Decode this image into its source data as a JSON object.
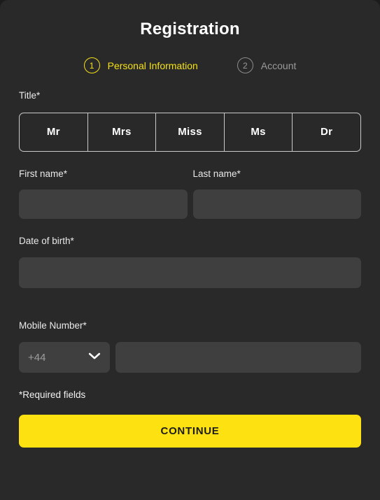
{
  "header": {
    "title": "Registration"
  },
  "stepper": {
    "steps": [
      {
        "number": "1",
        "label": "Personal Information",
        "state": "active"
      },
      {
        "number": "2",
        "label": "Account",
        "state": "inactive"
      }
    ]
  },
  "form": {
    "title_field": {
      "label": "Title*",
      "options": [
        "Mr",
        "Mrs",
        "Miss",
        "Ms",
        "Dr"
      ],
      "selected": ""
    },
    "first_name": {
      "label": "First name*",
      "value": "",
      "placeholder": ""
    },
    "last_name": {
      "label": "Last name*",
      "value": "",
      "placeholder": ""
    },
    "date_of_birth": {
      "label": "Date of birth*",
      "value": "",
      "placeholder": ""
    },
    "mobile_number": {
      "label": "Mobile Number*",
      "country_code": "+44",
      "country_code_icon": "chevron-down-icon",
      "value": "",
      "placeholder": ""
    },
    "required_note": "*Required fields",
    "submit_label": "CONTINUE"
  },
  "colors": {
    "accent": "#fde110",
    "accent_step": "#f5e117",
    "card_bg": "#292929",
    "input_bg": "#3f3f3f",
    "page_bg": "#1c1c1c",
    "text": "#ffffff",
    "muted": "#9a9a9a"
  }
}
